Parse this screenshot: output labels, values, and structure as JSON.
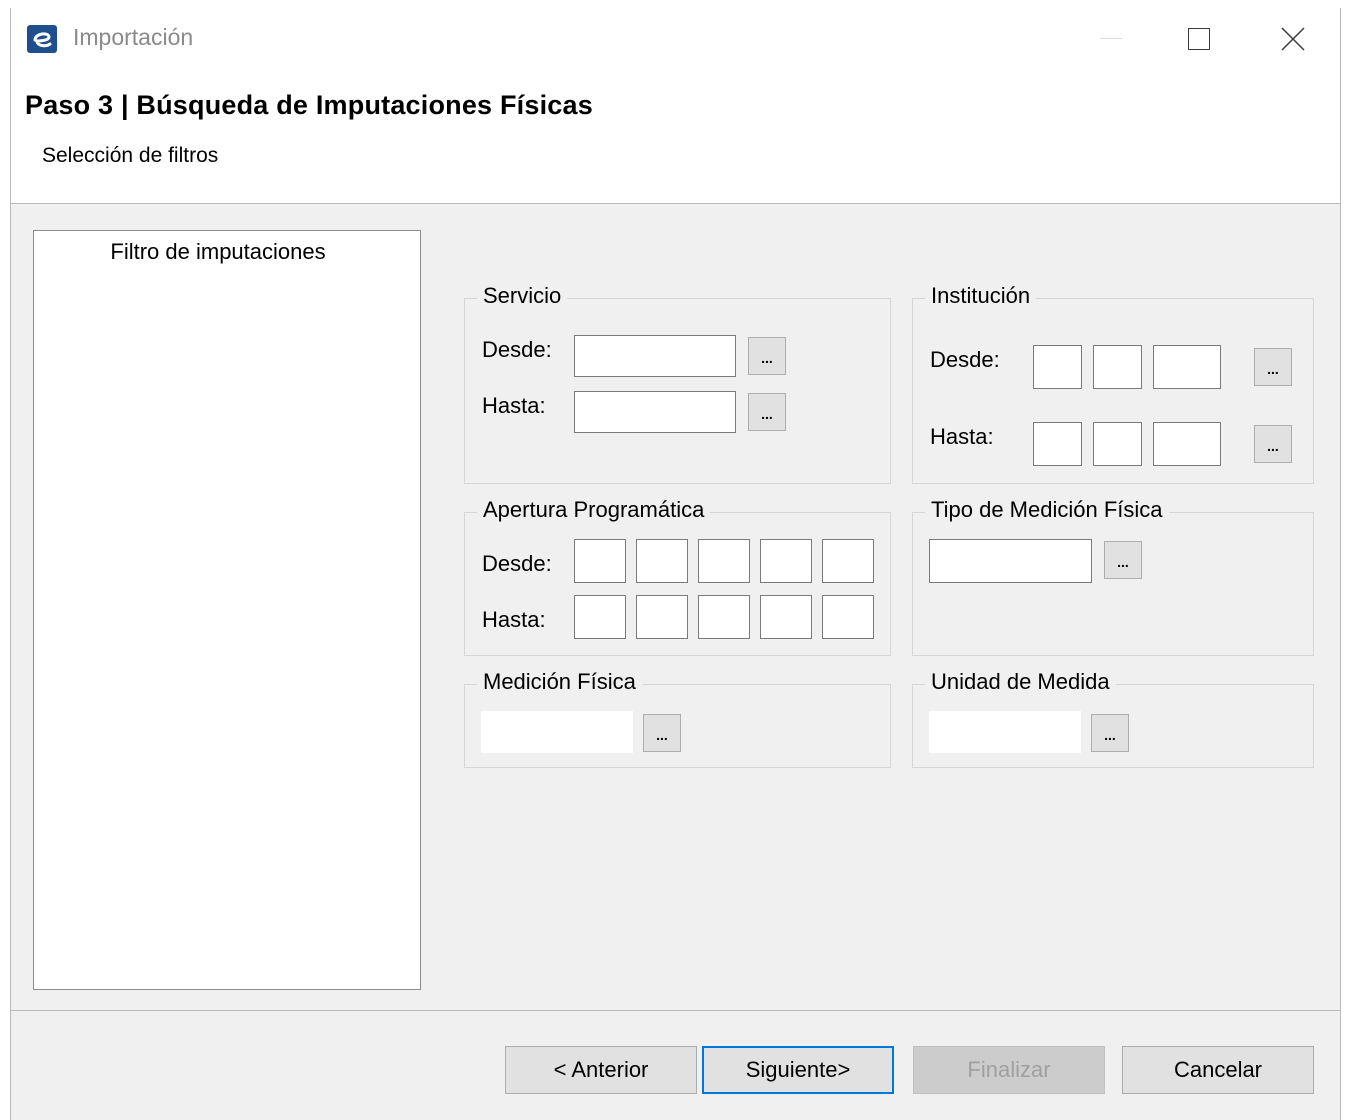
{
  "window": {
    "title": "Importación"
  },
  "header": {
    "step_title": "Paso 3 | Búsqueda de Imputaciones Físicas",
    "step_subtitle": "Selección de filtros"
  },
  "left_panel": {
    "title": "Filtro de imputaciones"
  },
  "groups": {
    "servicio": {
      "title": "Servicio",
      "desde_label": "Desde:",
      "hasta_label": "Hasta:"
    },
    "institucion": {
      "title": "Institución",
      "desde_label": "Desde:",
      "hasta_label": "Hasta:"
    },
    "apertura": {
      "title": "Apertura Programática",
      "desde_label": "Desde:",
      "hasta_label": "Hasta:"
    },
    "tipo_medicion": {
      "title": "Tipo de Medición Física"
    },
    "medicion": {
      "title": "Medición Física"
    },
    "unidad": {
      "title": "Unidad de Medida"
    }
  },
  "browse_label": "...",
  "footer": {
    "anterior": "< Anterior",
    "siguiente": "Siguiente>",
    "finalizar": "Finalizar",
    "cancelar": "Cancelar"
  },
  "colors": {
    "primary_border": "#0078d7",
    "accent_mark": "#e21c1c",
    "dialog_bg": "#f0f0f0"
  }
}
